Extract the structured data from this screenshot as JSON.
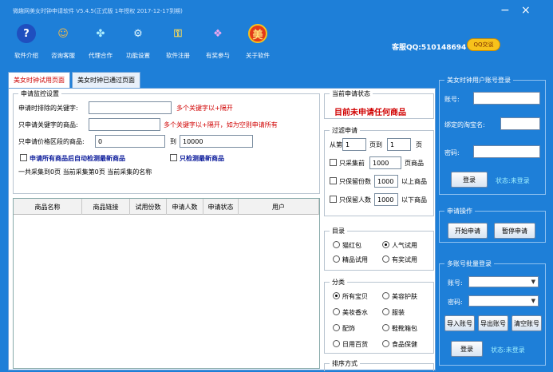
{
  "window": {
    "title": "微趣网美女时钟申请软件 V5.4.5(正式版 1年授权 2017-12-17到期)",
    "minimize": "−",
    "close": "×"
  },
  "toolbar": {
    "items": [
      {
        "label": "软件介绍",
        "icon": "question-icon",
        "glyph": "?",
        "color": "#1f4fbf"
      },
      {
        "label": "咨询客服",
        "icon": "support-people-icon",
        "glyph": "☺",
        "color": "#f2b94a"
      },
      {
        "label": "代理合作",
        "icon": "network-icon",
        "glyph": "✤",
        "color": "#2fa0e8"
      },
      {
        "label": "功能设置",
        "icon": "settings-globe-icon",
        "glyph": "⚙",
        "color": "#2a8fd0"
      },
      {
        "label": "软件注册",
        "icon": "key-icon",
        "glyph": "⚿",
        "color": "#e4c24a"
      },
      {
        "label": "有奖参与",
        "icon": "gift-icon",
        "glyph": "❖",
        "color": "#c060c0"
      },
      {
        "label": "关于软件",
        "icon": "mei-icon",
        "glyph": "美",
        "color": "#e33a1a"
      }
    ]
  },
  "customer_service": {
    "label": "客服QQ:510148694",
    "qq_button": "QQ交谈"
  },
  "tabs": [
    {
      "label": "美女时钟试用页面",
      "active": true
    },
    {
      "label": "美女时钟已通过页面",
      "active": false
    }
  ],
  "settings": {
    "legend": "申请监控设置",
    "keyword_label": "申请时排除的关键字:",
    "keyword_hint": "多个关键字以+隔开",
    "only_keyword_label": "只申请关键字的商品:",
    "only_keyword_hint": "多个关键字以+隔开，如为空则申请所有",
    "price_label": "只申请价格区段的商品:",
    "price_min": "0",
    "price_to": "到",
    "price_max": "10000",
    "check_new_label": "申请所有商品后自动检测最新商品",
    "only_new_label": "只检测最新商品",
    "summary": "一共采集到0页  当前采集第0页  当前采集的名称"
  },
  "table": {
    "columns": [
      "商品名称",
      "商品链接",
      "试用份数",
      "申请人数",
      "申请状态",
      "用户"
    ]
  },
  "status": {
    "legend": "当前申请状态",
    "text": "目前未申请任何商品"
  },
  "filter": {
    "legend": "过滤申请",
    "from_label": "从第",
    "from_value": "1",
    "page_to": "页到",
    "to_value": "1",
    "page": "页",
    "price_label": "只采集前",
    "price_value": "1000",
    "price_unit": "页商品",
    "copies_label": "只保留份数",
    "copies_value": "1000",
    "copies_unit": "以上商品",
    "people_label": "只保留人数",
    "people_value": "1000",
    "people_unit": "以下商品"
  },
  "directory": {
    "legend": "目录",
    "options": [
      {
        "label": "猫红包",
        "checked": false
      },
      {
        "label": "人气试用",
        "checked": true
      },
      {
        "label": "精品试用",
        "checked": false
      },
      {
        "label": "有奖试用",
        "checked": false
      }
    ]
  },
  "category": {
    "legend": "分类",
    "options": [
      {
        "label": "所有宝贝",
        "checked": true
      },
      {
        "label": "美容护肤",
        "checked": false
      },
      {
        "label": "美妆香水",
        "checked": false
      },
      {
        "label": "服装",
        "checked": false
      },
      {
        "label": "配饰",
        "checked": false
      },
      {
        "label": "鞋靴箱包",
        "checked": false
      },
      {
        "label": "日用百货",
        "checked": false
      },
      {
        "label": "食品保健",
        "checked": false
      }
    ],
    "next_legend": "排序方式"
  },
  "account": {
    "legend": "美女时钟用户账号登录",
    "username_label": "账号:",
    "shop_label": "绑定的淘宝名:",
    "password_label": "密码:",
    "login_button": "登录",
    "status": "状态:未登录"
  },
  "apply_ops": {
    "legend": "申请操作",
    "start_button": "开始申请",
    "pause_button": "暂停申请"
  },
  "multi_login": {
    "legend": "多账号批量登录",
    "username_label": "账号:",
    "password_label": "密码:",
    "import_button": "导入账号",
    "export_button": "导出账号",
    "clear_button": "清空账号",
    "login_button": "登录",
    "status": "状态:未登录"
  }
}
